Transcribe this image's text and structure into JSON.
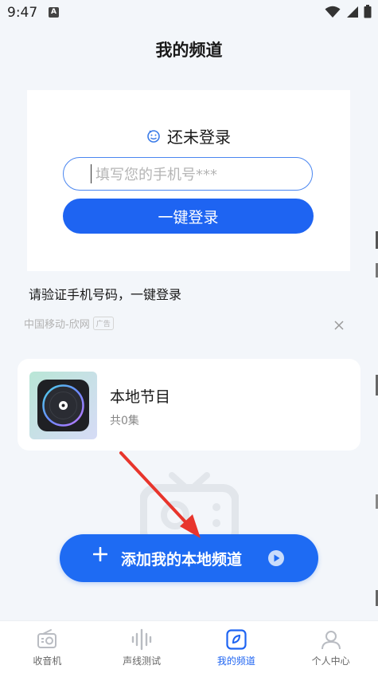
{
  "status_bar": {
    "time": "9:47",
    "notification_icon": "A"
  },
  "header": {
    "title": "我的频道"
  },
  "ad": {
    "login_title": "还未登录",
    "phone_placeholder": "填写您的手机号***",
    "login_button": "一键登录",
    "description": "请验证手机号码，一键登录",
    "source": "中国移动-欣网",
    "badge": "广告"
  },
  "program": {
    "title": "本地节目",
    "count": "共0集"
  },
  "add_channel": {
    "label": "添加我的本地频道"
  },
  "bottom_nav": {
    "items": [
      {
        "label": "收音机",
        "icon": "radio-icon",
        "active": false
      },
      {
        "label": "声线测试",
        "icon": "soundwave-icon",
        "active": false
      },
      {
        "label": "我的频道",
        "icon": "my-channel-icon",
        "active": true
      },
      {
        "label": "个人中心",
        "icon": "person-icon",
        "active": false
      }
    ]
  },
  "colors": {
    "accent": "#1e64f2",
    "annotation_arrow": "#e8352c"
  }
}
